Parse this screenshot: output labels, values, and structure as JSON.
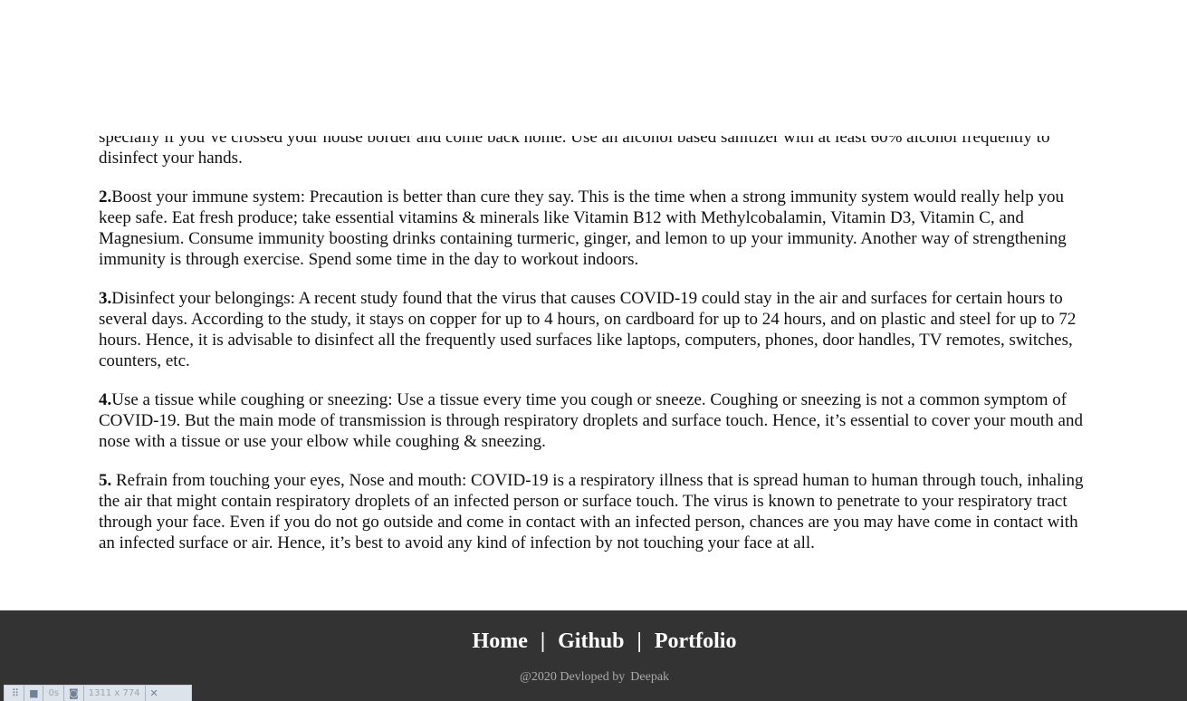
{
  "article": {
    "partial_text": "specially if you’ve crossed your house border and come back home. Use an alcohol based sanitizer with at least 60% alcohol frequently to disinfect your hands.",
    "tips": [
      {
        "num": "2.",
        "text": "Boost your immune system: Precaution is better than cure they say. This is the time when a strong immunity system would really help you keep safe. Eat fresh produce; take essential vitamins & minerals like Vitamin B12 with Methylcobalamin, Vitamin D3, Vitamin C, and Magnesium. Consume immunity boosting drinks containing turmeric, ginger, and lemon to up your immunity. Another way of strengthening immunity is through exercise. Spend some time in the day to workout indoors."
      },
      {
        "num": "3.",
        "text": "Disinfect your belongings: A recent study found that the virus that causes COVID-19 could stay in the air and surfaces for certain hours to several days. According to the study, it stays on copper for up to 4 hours, on cardboard for up to 24 hours, and on plastic and steel for up to 72 hours. Hence, it is advisable to disinfect all the frequently used surfaces like laptops, computers, phones, door handles, TV remotes, switches, counters, etc."
      },
      {
        "num": "4.",
        "text": "Use a tissue while coughing or sneezing: Use a tissue every time you cough or sneeze. Coughing or sneezing is not a common symptom of COVID-19. But the main mode of transmission is through respiratory droplets and surface touch. Hence, it’s essential to cover your mouth and nose with a tissue or use your elbow while coughing & sneezing."
      },
      {
        "num": "5.",
        "text": " Refrain from touching your eyes, Nose and mouth: COVID-19 is a respiratory illness that is spread human to human through touch, inhaling the air that might contain respiratory droplets of an infected person or surface touch. The virus is known to penetrate to your respiratory tract through your face. Even if you do not go outside and come in contact with an infected person, chances are you may have come in contact with an infected surface or air. Hence, it’s best to avoid any kind of infection by not touching your face at all."
      }
    ]
  },
  "footer": {
    "links": [
      "Home",
      "Github",
      "Portfolio"
    ],
    "separator": "|",
    "copyright": "@2020 Devloped by",
    "author": "Deepak"
  },
  "toolbar": {
    "drag_glyph": "⠿",
    "camera_glyph": "■",
    "photo_glyph": "◙",
    "close_glyph": "✕",
    "timer": "0s",
    "dimensions": "1311 x 774"
  },
  "colors": {
    "footer_bg": "#333333",
    "footer_text": "#ffffff",
    "copyright_text": "#aaaaaa"
  }
}
